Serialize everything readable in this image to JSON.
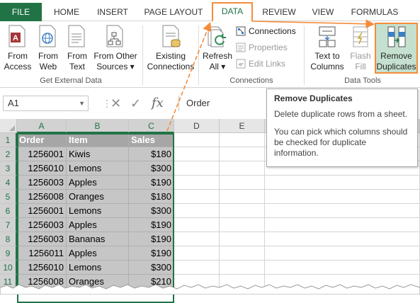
{
  "tabs": [
    {
      "label": "FILE",
      "active": false
    },
    {
      "label": "HOME",
      "active": false
    },
    {
      "label": "INSERT",
      "active": false
    },
    {
      "label": "PAGE LAYOUT",
      "active": false
    },
    {
      "label": "DATA",
      "active": true
    },
    {
      "label": "REVIEW",
      "active": false
    },
    {
      "label": "VIEW",
      "active": false
    },
    {
      "label": "FORMULAS",
      "active": false
    }
  ],
  "ribbon": {
    "get_external_data": {
      "label": "Get External Data",
      "from_access": [
        "From",
        "Access"
      ],
      "from_web": [
        "From",
        "Web"
      ],
      "from_text": [
        "From",
        "Text"
      ],
      "from_other_sources": [
        "From Other",
        "Sources ▾"
      ]
    },
    "existing_connections": [
      "Existing",
      "Connections"
    ],
    "connections": {
      "label": "Connections",
      "refresh_all": [
        "Refresh",
        "All ▾"
      ],
      "connections": "Connections",
      "properties": "Properties",
      "edit_links": "Edit Links"
    },
    "data_tools": {
      "label": "Data Tools",
      "text_to_columns": [
        "Text to",
        "Columns"
      ],
      "flash_fill": [
        "Flash",
        "Fill"
      ],
      "remove_duplicates": [
        "Remove",
        "Duplicates"
      ]
    }
  },
  "formula_bar": {
    "name_box": "A1",
    "cancel_glyph": "✕",
    "enter_glyph": "✓",
    "fx_glyph": "fx",
    "content": "Order"
  },
  "tooltip": {
    "title": "Remove Duplicates",
    "line1": "Delete duplicate rows from a sheet.",
    "line2": "You can pick which columns should be checked for duplicate information."
  },
  "sheet": {
    "columns": [
      "A",
      "B",
      "C",
      "D",
      "E"
    ],
    "rows": [
      "1",
      "2",
      "3",
      "4",
      "5",
      "6",
      "7",
      "8",
      "9",
      "10",
      "11"
    ],
    "header": [
      "Order",
      "Item",
      "Sales"
    ],
    "data": [
      [
        "1256001",
        "Kiwis",
        "$180"
      ],
      [
        "1256010",
        "Lemons",
        "$300"
      ],
      [
        "1256003",
        "Apples",
        "$190"
      ],
      [
        "1256008",
        "Oranges",
        "$180"
      ],
      [
        "1256001",
        "Lemons",
        "$300"
      ],
      [
        "1256003",
        "Apples",
        "$190"
      ],
      [
        "1256003",
        "Bananas",
        "$190"
      ],
      [
        "1256011",
        "Apples",
        "$190"
      ],
      [
        "1256010",
        "Lemons",
        "$300"
      ],
      [
        "1256008",
        "Oranges",
        "$210"
      ]
    ]
  },
  "colors": {
    "excel_green": "#217346",
    "highlight_orange": "#f58c3a",
    "selection_gray": "#c6c6c6",
    "header_gray": "#a6a6a6"
  }
}
